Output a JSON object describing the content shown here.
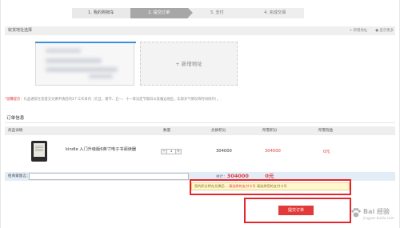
{
  "steps": [
    {
      "label": "1. 我的购物车",
      "state": "done"
    },
    {
      "label": "2. 提交订单",
      "state": "current"
    },
    {
      "label": "3. 支付",
      "state": "todo"
    },
    {
      "label": "4. 完成交易",
      "state": "todo"
    }
  ],
  "address": {
    "header": "收货地址选择",
    "add_link": "+ 新增地址",
    "manage_link": "● 显示更多",
    "new_card": "+ 新增地址"
  },
  "notice": {
    "prefix": "*温馨提示：",
    "text": "礼品通常在您提交兑换申请后的3个工作日内（元旦、春节、五一、十一等法定节假日以及偏远地区，实际天气情况等时间除外）。"
  },
  "order": {
    "title": "订单信息",
    "columns": [
      "商品详情",
      "数量",
      "兑换积分",
      "所需积分",
      "所需现金"
    ],
    "items": [
      {
        "name": "kindle 入门升级版6英寸电子书阅读器",
        "qty": "1",
        "price": "304000",
        "points": "304000",
        "cash": "0元"
      }
    ]
  },
  "remarks": {
    "label": "给商家留言：",
    "placeholder": "",
    "total_label": "共计：",
    "total_value": "304000",
    "zero_value": "0元"
  },
  "hint": {
    "text": "您的积分将在兑换后...",
    "card": "请选择的支付卡号",
    "choose": "请选择您的支付卡号"
  },
  "submit_label": "提交订单",
  "watermark": {
    "line1": "Bai 经验",
    "line2": "jingyan.baidu.com"
  },
  "colors": {
    "accent_red": "#e23a3a",
    "selection_blue": "#3b8fdc",
    "highlight_box": "#e5262f"
  }
}
